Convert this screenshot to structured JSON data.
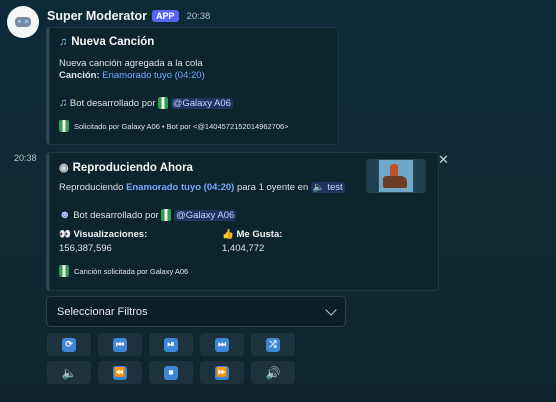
{
  "message": {
    "username": "Super Moderator",
    "badge": "APP",
    "timestamp": "20:38",
    "second_timestamp": "20:38"
  },
  "embed1": {
    "title": "Nueva Canción",
    "line1": "Nueva canción agregada a la cola",
    "song_label": "Canción:",
    "song_value": "Enamorado tuyo (04:20)",
    "dev_prefix": "Bot desarrollado por",
    "dev_mention": "@Galaxy A06",
    "footer": "Solicitado por Galaxy A06 • Bot por <@1404572152014962706>"
  },
  "embed2": {
    "title": "Reproduciendo Ahora",
    "playing_prefix": "Reproduciendo",
    "playing_song": "Enamorado tuyo (04:20)",
    "playing_mid": "para 1 oyente en",
    "channel": "test",
    "dev_prefix": "Bot desarrollado por",
    "dev_mention": "@Galaxy A06",
    "views_label": "Visualizaciones:",
    "views_value": "156,387,596",
    "likes_label": "Me Gusta:",
    "likes_value": "1,404,772",
    "footer": "Canción solicitada por Galaxy A06"
  },
  "select": {
    "placeholder": "Seleccionar Filtros"
  },
  "icons": [
    "robot-avatar-icon",
    "notes-icon",
    "disc-icon",
    "eyes-icon",
    "thumbs-up-icon",
    "speaker-icon",
    "close-icon",
    "chevron-down-icon"
  ],
  "controls_row1": [
    "repeat",
    "previous",
    "play-pause",
    "next",
    "shuffle"
  ],
  "controls_row2": [
    "volume-down",
    "rewind",
    "stop",
    "forward",
    "volume-up"
  ],
  "colors": {
    "accent": "#5865f2",
    "link": "#7aa9ff",
    "button_icon": "#3d86d6"
  }
}
